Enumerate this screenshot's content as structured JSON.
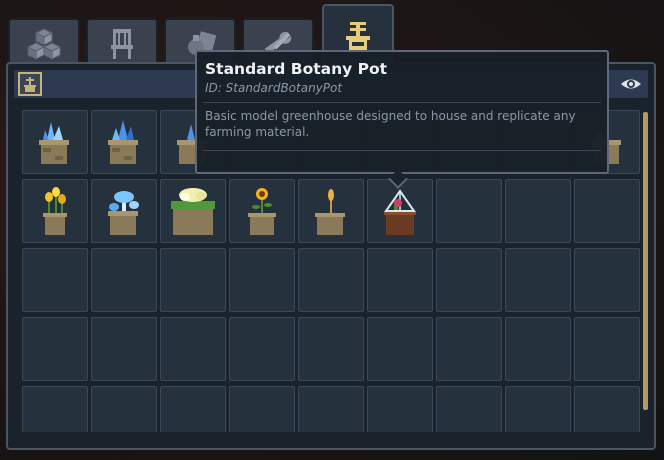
{
  "tabs": [
    {
      "name": "tab-blocks",
      "icon": "cubes-icon"
    },
    {
      "name": "tab-furniture",
      "icon": "chair-icon"
    },
    {
      "name": "tab-tools",
      "icon": "potion-icon"
    },
    {
      "name": "tab-wrench",
      "icon": "wrench-icon"
    },
    {
      "name": "tab-botany",
      "icon": "botany-pot-icon",
      "active": true
    }
  ],
  "toolbar": {
    "visibility_icon": "eye-icon"
  },
  "tooltip": {
    "title": "Standard Botany Pot",
    "id": "ID: StandardBotanyPot",
    "description": "Basic model greenhouse designed to house and replicate any farming material."
  },
  "inventory": {
    "row1": [
      "blue-crystal-pot",
      "blue-crystal-pot",
      "blue-crystal-pot",
      "hidden",
      "hidden",
      "hidden",
      "hidden",
      "hidden",
      "orange-flower-pot"
    ],
    "row2": [
      "yellow-tulip-pot",
      "blue-mushroom-pot",
      "white-flower-hanging-pot",
      "sunflower-pot",
      "wheat-pot",
      "standard-botany-pot",
      "empty",
      "empty",
      "empty"
    ]
  },
  "colors": {
    "accent": "#e2c779",
    "panel": "#1a222c",
    "slot": "#26313e"
  }
}
